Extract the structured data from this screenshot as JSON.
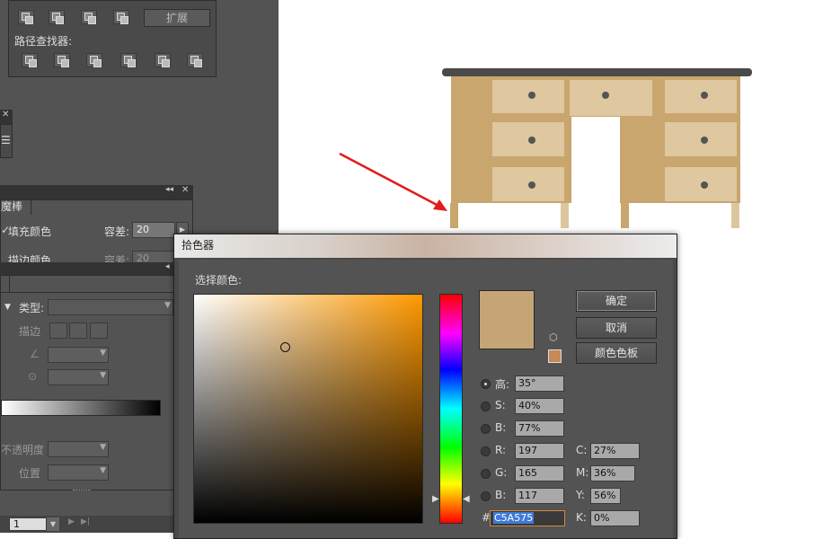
{
  "pathfinder": {
    "expand_label": "扩展",
    "pathfinders_label": "路径查找器:"
  },
  "magic_wand": {
    "tab": "魔棒",
    "fill_color": "填充颜色",
    "stroke_color": "描边颜色",
    "tolerance_label": "容差:",
    "tolerance_value": "20",
    "tolerance_value_2": "20"
  },
  "gradient": {
    "type_label": "类型:",
    "stroke_label": "描边",
    "opacity_label": "不透明度",
    "position_label": "位置"
  },
  "statusbar": {
    "page": "1"
  },
  "color_picker": {
    "title": "拾色器",
    "select_color_label": "选择颜色:",
    "ok": "确定",
    "cancel": "取消",
    "swatches": "颜色色板",
    "h_label": "高:",
    "h_value": "35°",
    "s_label": "S:",
    "s_value": "40%",
    "b_label": "B:",
    "b_value": "77%",
    "r_label": "R:",
    "r_value": "197",
    "g_label": "G:",
    "g_value": "165",
    "b2_label": "B:",
    "b2_value": "117",
    "c_label": "C:",
    "c_value": "27%",
    "m_label": "M:",
    "m_value": "36%",
    "y_label": "Y:",
    "y_value": "56%",
    "k_label": "K:",
    "k_value": "0%",
    "hex_label": "#",
    "hex_value": "C5A575",
    "selected_color": "#C5A575"
  },
  "colors": {
    "desk_body": "#c9a66e",
    "desk_drawer": "#dfc79f",
    "desk_top": "#4a4a4a",
    "desk_leg": "#dcc6a0",
    "arrow": "#e21b1b"
  }
}
